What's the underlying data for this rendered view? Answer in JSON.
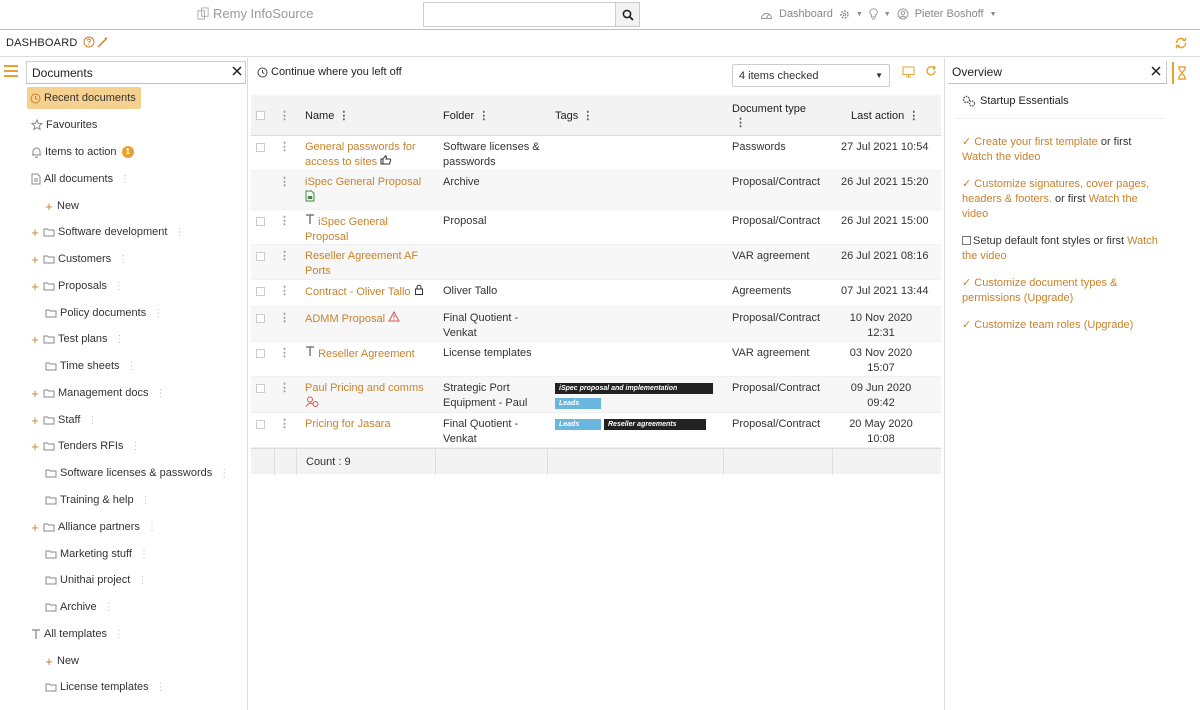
{
  "app": {
    "brand": "Remy InfoSource",
    "search_placeholder": "",
    "nav": {
      "dashboard": "Dashboard",
      "user": "Pieter Boshoff"
    }
  },
  "subbar": {
    "title": "DASHBOARD"
  },
  "sidebar": {
    "title": "Documents",
    "items": [
      {
        "label": "Recent documents"
      },
      {
        "label": "Favourites"
      },
      {
        "label": "Items to action",
        "badge": "1"
      },
      {
        "label": "All documents"
      },
      {
        "label": "New"
      },
      {
        "label": "Software development"
      },
      {
        "label": "Customers"
      },
      {
        "label": "Proposals"
      },
      {
        "label": "Policy documents"
      },
      {
        "label": "Test plans"
      },
      {
        "label": "Time sheets"
      },
      {
        "label": "Management docs"
      },
      {
        "label": "Staff"
      },
      {
        "label": "Tenders RFIs"
      },
      {
        "label": "Software licenses & passwords"
      },
      {
        "label": "Training & help"
      },
      {
        "label": "Alliance partners"
      },
      {
        "label": "Marketing stuff"
      },
      {
        "label": "Unithai project"
      },
      {
        "label": "Archive"
      },
      {
        "label": "All templates"
      },
      {
        "label": "New"
      },
      {
        "label": "License templates"
      }
    ]
  },
  "main": {
    "continue_label": "Continue where you left off",
    "checked_select": "4 items checked",
    "columns": {
      "name": "Name",
      "folder": "Folder",
      "tags": "Tags",
      "doctype": "Document type",
      "last": "Last action"
    },
    "rows": [
      {
        "name": "General passwords for access to sites",
        "folder": "Software licenses & passwords",
        "doctype": "Passwords",
        "last": "27 Jul 2021 10:54"
      },
      {
        "name": "iSpec General Proposal",
        "folder": "Archive",
        "doctype": "Proposal/Contract",
        "last": "26 Jul 2021 15:20"
      },
      {
        "name": "iSpec General Proposal",
        "folder": "Proposal",
        "doctype": "Proposal/Contract",
        "last": "26 Jul 2021 15:00"
      },
      {
        "name": "Reseller Agreement AF Ports",
        "folder": "",
        "doctype": "VAR agreement",
        "last": "26 Jul 2021 08:16"
      },
      {
        "name": "Contract - Oliver Tallo",
        "folder": "Oliver Tallo",
        "doctype": "Agreements",
        "last": "07 Jul 2021 13:44"
      },
      {
        "name": "ADMM Proposal",
        "folder": "Final Quotient - Venkat",
        "doctype": "Proposal/Contract",
        "last": "10 Nov 2020 12:31"
      },
      {
        "name": "Reseller Agreement",
        "folder": "License templates",
        "doctype": "VAR agreement",
        "last": "03 Nov 2020 15:07"
      },
      {
        "name": "Paul Pricing and comms",
        "folder": "Strategic Port Equipment - Paul",
        "doctype": "Proposal/Contract",
        "last": "09 Jun 2020 09:42",
        "tags": [
          "iSpec proposal and implementation",
          "Leads"
        ]
      },
      {
        "name": "Pricing for Jasara",
        "folder": "Final Quotient - Venkat",
        "doctype": "Proposal/Contract",
        "last": "20 May 2020 10:08",
        "tags": [
          "Leads",
          "Reseller agreements"
        ]
      }
    ],
    "count_label": "Count : 9"
  },
  "overview": {
    "title": "Overview",
    "startup": "Startup Essentials",
    "items": [
      {
        "link": "Create your first template",
        "mid": " or first ",
        "link2": "Watch the video"
      },
      {
        "link": "Customize signatures, cover pages, headers & footers.",
        "mid": " or first ",
        "link2": "Watch the video"
      },
      {
        "text": "Setup default font styles",
        "mid": " or first ",
        "link2": "Watch the video"
      },
      {
        "link": "Customize document types & permissions (Upgrade)"
      },
      {
        "link": "Customize team roles (Upgrade)"
      }
    ]
  },
  "colors": {
    "accent": "#c9822b",
    "active_bg": "#f5d08f",
    "tag_black": "#222222",
    "tag_blue": "#6bb6de"
  }
}
